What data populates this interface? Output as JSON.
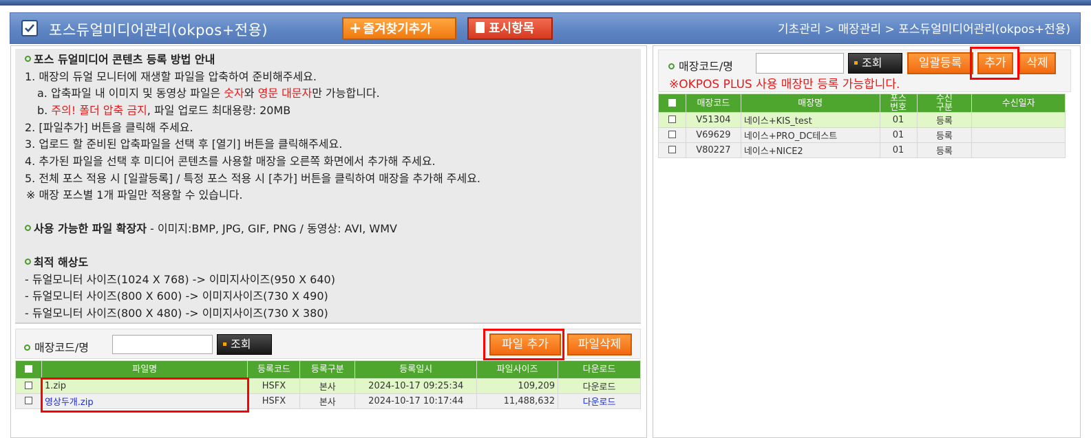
{
  "header": {
    "title": "포스듀얼미디어관리(okpos+전용)",
    "favorite_button": "즐겨찾기추가",
    "display_button": "표시항목",
    "breadcrumb": "기초관리 > 매장관리 > 포스듀얼미디어관리(okpos+전용)"
  },
  "guide": {
    "title": "포스 듀얼미디어 콘텐츠 등록 방법 안내",
    "line1": "1. 매장의 듀얼 모니터에 재생할 파일을 압축하여 준비해주세요.",
    "line2_a": "a. 압축파일 내 이미지 및 동영상 파일은 ",
    "line2_num": "숫자",
    "line2_and": "와 ",
    "line2_upper": "영문 대문자",
    "line2_end": "만 가능합니다.",
    "line3_b": "b. ",
    "line3_warn": "주의! 폴더 압축 금지",
    "line3_end": ", 파일 업로드 최대용량: 20MB",
    "line4": "2. [파일추가] 버튼을 클릭해 주세요.",
    "line5": "3. 업로드 할 준비된 압축파일을 선택 후 [열기] 버튼을 클릭해주세요.",
    "line6": "4. 추가된 파일을 선택 후 미디어 콘텐츠를 사용할 매장을 오른쪽 화면에서 추가해 주세요.",
    "line7": "5. 전체 포스 적용 시 [일괄등록] / 특정 포스 적용 시 [추가] 버튼을 클릭하여 매장을 추가해 주세요.",
    "line8": "※ 매장 포스별 1개 파일만 적용할 수 있습니다.",
    "ext_title": "사용 가능한 파일 확장자",
    "ext_text": " - 이미지:BMP, JPG, GIF, PNG / 동영상: AVI, WMV",
    "res_title": "최적 해상도",
    "res1": "- 듀얼모니터 사이즈(1024 X 768) -> 이미지사이즈(950 X 640)",
    "res2": "- 듀얼모니터 사이즈(800 X 600) -> 이미지사이즈(730 X 490)",
    "res3": "- 듀얼모니터 사이즈(800 X 480) -> 이미지사이즈(730 X 380)"
  },
  "file_search": {
    "label": "매장코드/명",
    "input_value": "",
    "search_button": "조회",
    "add_file_button": "파일 추가",
    "delete_file_button": "파일삭제"
  },
  "file_table": {
    "headers": [
      "파일명",
      "등록코드",
      "등록구분",
      "등록일시",
      "파일사이즈",
      "다운로드"
    ],
    "rows": [
      {
        "name": "1.zip",
        "code": "HSFX",
        "type": "본사",
        "date": "2024-10-17 09:25:34",
        "size": "109,209",
        "download": "다운로드"
      },
      {
        "name": "영상두개.zip",
        "code": "HSFX",
        "type": "본사",
        "date": "2024-10-17 10:17:44",
        "size": "11,488,632",
        "download": "다운로드"
      }
    ]
  },
  "store_search": {
    "label": "매장코드/명",
    "input_value": "",
    "search_button": "조회",
    "bulk_button": "일괄등록",
    "add_button": "추가",
    "delete_button": "삭제",
    "notice": "※OKPOS PLUS 사용 매장만 등록 가능합니다."
  },
  "store_table": {
    "headers": [
      "매장코드",
      "매장명",
      "포스\n번호",
      "수신\n구분",
      "수신일자"
    ],
    "rows": [
      {
        "code": "V51304",
        "name": "네이스+KIS_test",
        "pos": "01",
        "recv": "등록",
        "date": ""
      },
      {
        "code": "V69629",
        "name": "네이스+PRO_DC테스트",
        "pos": "01",
        "recv": "등록",
        "date": ""
      },
      {
        "code": "V80227",
        "name": "네이스+NICE2",
        "pos": "01",
        "recv": "등록",
        "date": ""
      }
    ]
  },
  "colors": {
    "accent_orange": "#f07a10",
    "table_header_green": "#4ea62e",
    "highlight_red": "#ff0000",
    "notice_red": "#e31b1b"
  }
}
